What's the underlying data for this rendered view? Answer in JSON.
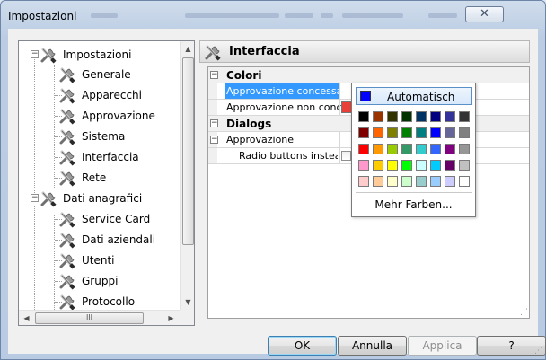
{
  "window": {
    "title": "Impostazioni",
    "close_glyph": "✕"
  },
  "tree": {
    "items": [
      {
        "label": "Impostazioni",
        "expander": "−"
      },
      {
        "label": "Generale"
      },
      {
        "label": "Apparecchi"
      },
      {
        "label": "Approvazione"
      },
      {
        "label": "Sistema"
      },
      {
        "label": "Interfaccia"
      },
      {
        "label": "Rete"
      },
      {
        "label": "Dati anagrafici",
        "expander": "−"
      },
      {
        "label": "Service Card"
      },
      {
        "label": "Dati aziendali"
      },
      {
        "label": "Utenti"
      },
      {
        "label": "Gruppi"
      },
      {
        "label": "Protocollo"
      }
    ],
    "hscroll_thumb": "III",
    "scroll_up": "▲",
    "scroll_down": "▼",
    "scroll_left": "◀",
    "scroll_right": "▶"
  },
  "panel": {
    "title": "Interfaccia"
  },
  "grid": {
    "collapse_glyph": "−",
    "cat_colori": "Colori",
    "approvazione_concessa": "Approvazione concessa",
    "approvazione_non_concessa": "Approvazione non conce...",
    "approvazione_non_concessa_color": "#e8413a",
    "cat_dialogs": "Dialogs",
    "approvazione": "Approvazione",
    "radio_buttons": "Radio buttons instead ..."
  },
  "color_popup": {
    "automatic_label": "Automatisch",
    "automatic_color": "#0000ff",
    "more_label": "Mehr Farben...",
    "palette": [
      [
        "#000000",
        "#993300",
        "#333300",
        "#003300",
        "#003366",
        "#000080",
        "#333399",
        "#333333"
      ],
      [
        "#800000",
        "#ff6600",
        "#808000",
        "#008000",
        "#008080",
        "#0000ff",
        "#666699",
        "#808080"
      ],
      [
        "#ff0000",
        "#ff9900",
        "#99cc00",
        "#339966",
        "#33cccc",
        "#3366ff",
        "#800080",
        "#969696"
      ],
      [
        "#ff99cc",
        "#ffcc00",
        "#ffff00",
        "#00ff00",
        "#ccffff",
        "#00ccff",
        "#660066",
        "#c0c0c0"
      ],
      [
        "#ffcccc",
        "#ffcc99",
        "#ffffcc",
        "#ccffcc",
        "#99cccc",
        "#99ccff",
        "#ccccff",
        "#ffffff"
      ]
    ]
  },
  "buttons": {
    "ok": "OK",
    "annulla": "Annulla",
    "applica": "Applica",
    "help": "?"
  }
}
